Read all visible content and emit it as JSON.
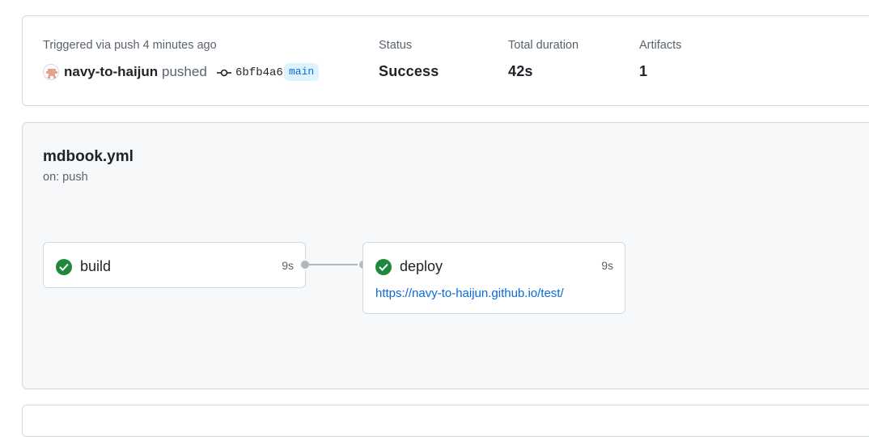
{
  "summary": {
    "trigger_text": "Triggered via push 4 minutes ago",
    "actor": "navy-to-haijun",
    "action": "pushed",
    "commit_sha": "6bfb4a6",
    "branch": "main",
    "status_label": "Status",
    "status_value": "Success",
    "duration_label": "Total duration",
    "duration_value": "42s",
    "artifacts_label": "Artifacts",
    "artifacts_value": "1"
  },
  "workflow": {
    "name": "mdbook.yml",
    "trigger": "on: push",
    "jobs": [
      {
        "name": "build",
        "duration": "9s",
        "status": "success"
      },
      {
        "name": "deploy",
        "duration": "9s",
        "status": "success",
        "url": "https://navy-to-haijun.github.io/test/"
      }
    ]
  },
  "colors": {
    "success": "#1f883d",
    "link": "#0969da",
    "branch_bg": "#ddf4ff",
    "graph_bg": "#f6f8fa"
  },
  "icons": {
    "commit": "git-commit-icon",
    "status": "check-circle-fill-icon"
  }
}
